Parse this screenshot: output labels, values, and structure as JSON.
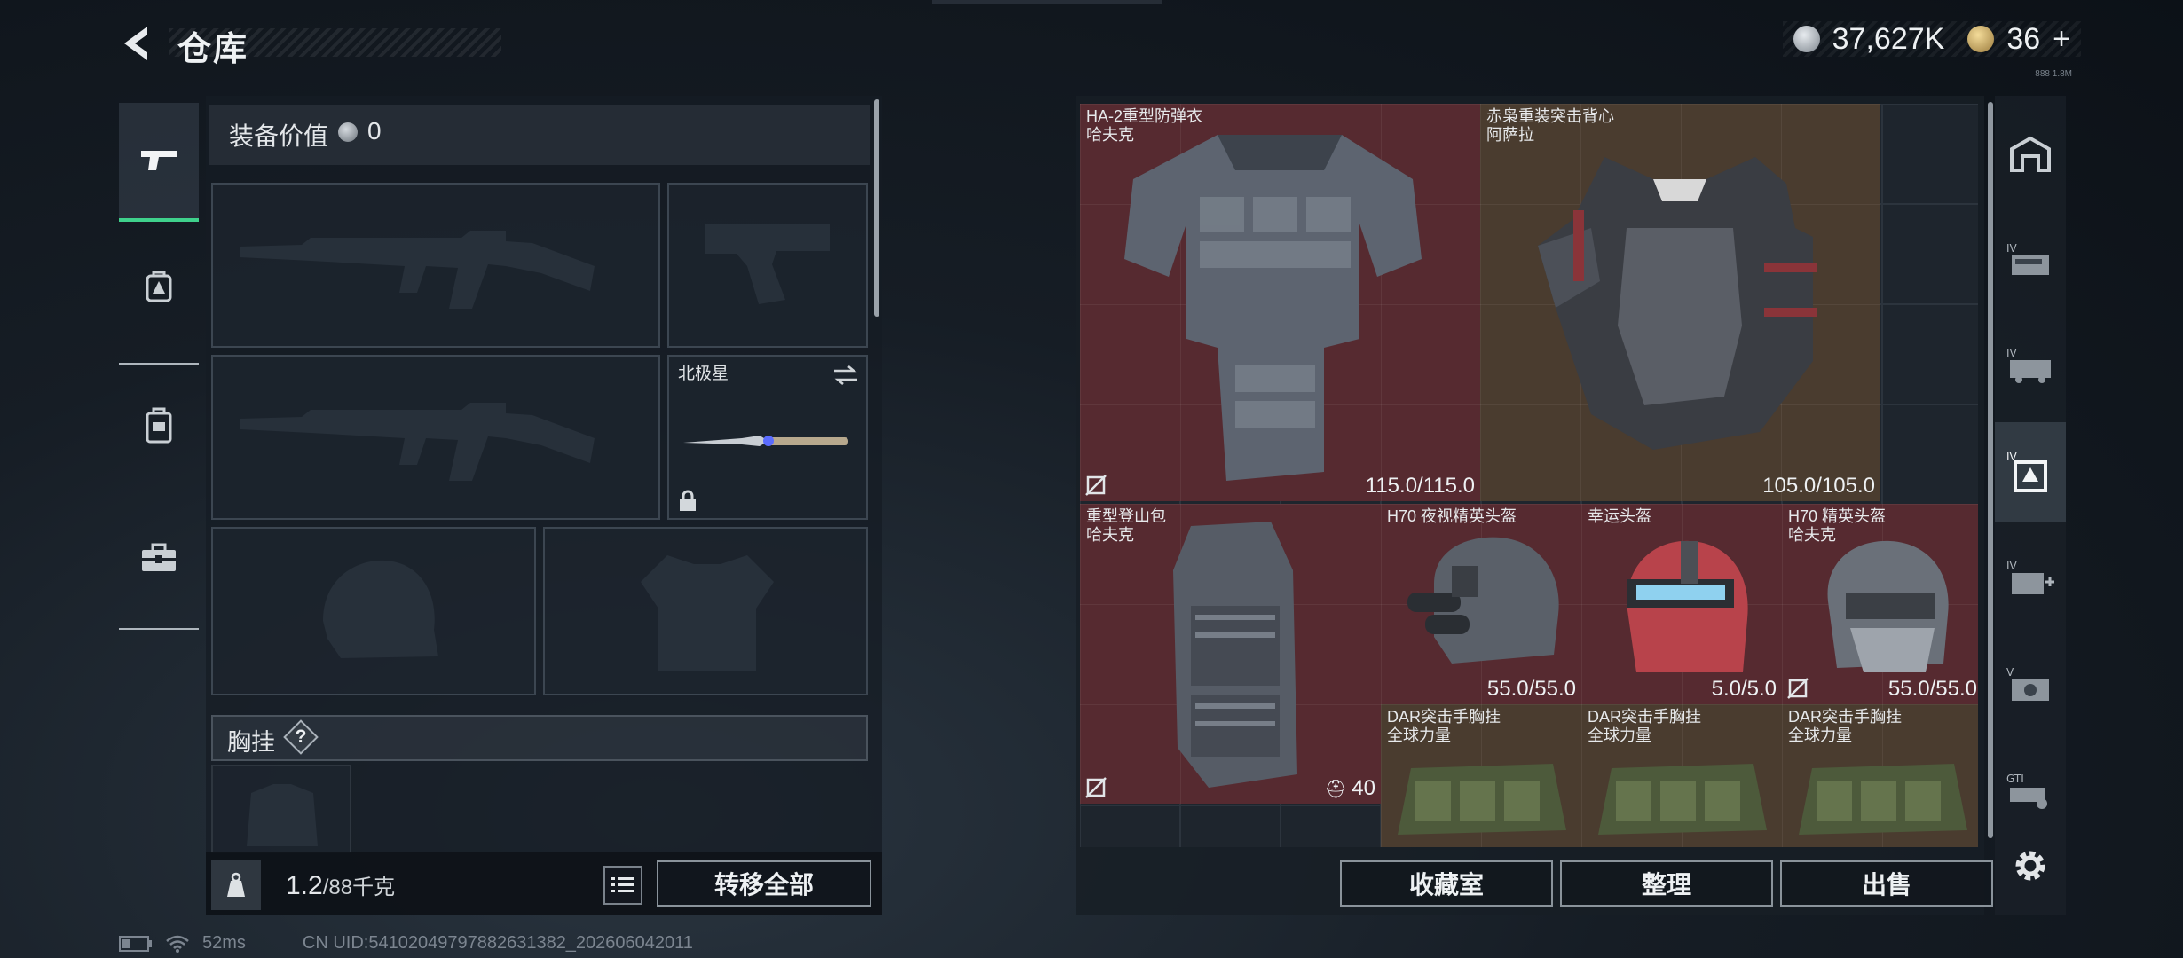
{
  "header": {
    "title": "仓库",
    "currency": [
      {
        "value": "37,627K",
        "color": "#c8ced4"
      },
      {
        "value": "36",
        "color": "#d9b86a",
        "suffix": "+"
      }
    ],
    "note": "888 1.8M"
  },
  "left_nav": [
    "pistol-icon",
    "backpack-icon",
    "vest-icon",
    "toolbox-icon"
  ],
  "loadout": {
    "equip_label": "装备价值",
    "equip_value": "0",
    "melee_name": "北极星",
    "section_label": "胸挂",
    "help": "?",
    "weight_current": "1.2",
    "weight_max": "/88千克",
    "transfer_all": "转移全部"
  },
  "inventory": {
    "items": [
      {
        "name": "HA-2重型防弹衣",
        "brand": "哈夫克",
        "durability": "115.0/115.0",
        "rarity": "red"
      },
      {
        "name": "赤枭重装突击背心",
        "brand": "阿萨拉",
        "durability": "105.0/105.0",
        "rarity": "gold"
      },
      {
        "name": "重型登山包",
        "brand": "哈夫克",
        "capacity": "40",
        "rarity": "red"
      },
      {
        "name": "H70 夜视精英头盔",
        "brand": "",
        "durability": "55.0/55.0",
        "rarity": "red"
      },
      {
        "name": "幸运头盔",
        "brand": "",
        "durability": "5.0/5.0",
        "rarity": "red"
      },
      {
        "name": "H70 精英头盔",
        "brand": "哈夫克",
        "durability": "55.0/55.0",
        "rarity": "red"
      },
      {
        "name": "DAR突击手胸挂",
        "brand": "全球力量",
        "rarity": "gold"
      },
      {
        "name": "DAR突击手胸挂",
        "brand": "全球力量",
        "rarity": "gold"
      },
      {
        "name": "DAR突击手胸挂",
        "brand": "全球力量",
        "rarity": "gold"
      }
    ],
    "buttons": {
      "collection": "收藏室",
      "sort": "整理",
      "sell": "出售"
    }
  },
  "right_nav": [
    "warehouse-icon",
    "tier4-gun-icon",
    "tier4-truck-icon",
    "tier4-vest-icon",
    "tier4-medkit-icon",
    "tier5-gear-icon",
    "gti-truck-icon",
    "settings-icon"
  ],
  "status": {
    "ping": "52ms",
    "uid": "CN UID:5410204979788263138​2_202606042011"
  }
}
